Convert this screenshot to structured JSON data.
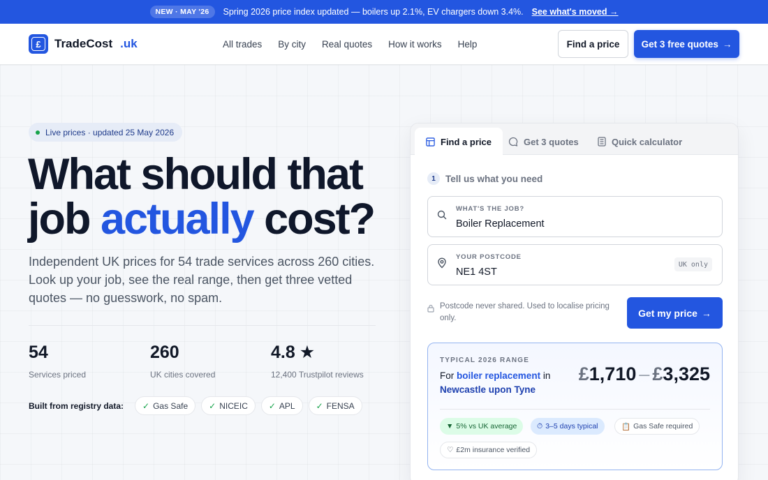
{
  "announcement": {
    "badge": "NEW · MAY '26",
    "text": "Spring 2026 price index updated — boilers up 2.1%, EV chargers down 3.4%.",
    "link": "See what's moved →"
  },
  "header": {
    "logo_symbol": "£",
    "brand": "TradeCost",
    "tld": ".uk",
    "nav": [
      "All trades",
      "By city",
      "Real quotes",
      "How it works",
      "Help"
    ],
    "find_price": "Find a price",
    "get_quotes": "Get 3 free quotes",
    "arrow": "→"
  },
  "hero": {
    "live": "Live prices · updated 25 May 2026",
    "headline_1": "What should that",
    "headline_2a": "job ",
    "headline_2b": "actually",
    "headline_2c": " cost?",
    "lede": "Independent UK prices for 54 trade services across 260 cities. Look up your job, see the real range, then get three vetted quotes — no guesswork, no spam.",
    "stats": [
      {
        "value": "54",
        "label": "Services priced"
      },
      {
        "value": "260",
        "label": "UK cities covered"
      },
      {
        "value": "4.8",
        "star": "★",
        "label": "12,400 Trustpilot reviews"
      }
    ],
    "built_title": "Built from registry data:",
    "registries": [
      "Gas Safe",
      "NICEIC",
      "APL",
      "FENSA"
    ],
    "check": "✓"
  },
  "card": {
    "tabs": [
      "Find a price",
      "Get 3 quotes",
      "Quick calculator"
    ],
    "step_num": "1",
    "step_text": "Tell us what you need",
    "job_label": "WHAT'S THE JOB?",
    "job_value": "Boiler Replacement",
    "postcode_label": "YOUR POSTCODE",
    "postcode_value": "NE1 4ST",
    "uk_only": "UK only",
    "privacy": "Postcode never shared. Used to localise pricing only.",
    "submit": "Get my price",
    "range": {
      "label": "TYPICAL 2026 RANGE",
      "desc_for": "For ",
      "desc_job": "boiler replacement",
      "desc_in": " in ",
      "desc_city": "Newcastle upon Tyne",
      "currency": "£",
      "low": "1,710",
      "dash": "–",
      "high": "3,325",
      "tags": [
        {
          "icon": "▼",
          "text": "5% vs UK average"
        },
        {
          "icon": "⏱",
          "text": "3–5 days typical"
        },
        {
          "icon": "📋",
          "text": "Gas Safe required"
        },
        {
          "icon": "♡",
          "text": "£2m insurance verified"
        }
      ]
    }
  },
  "colors": {
    "brand": "#2356e0",
    "positive": "#16a34a"
  }
}
